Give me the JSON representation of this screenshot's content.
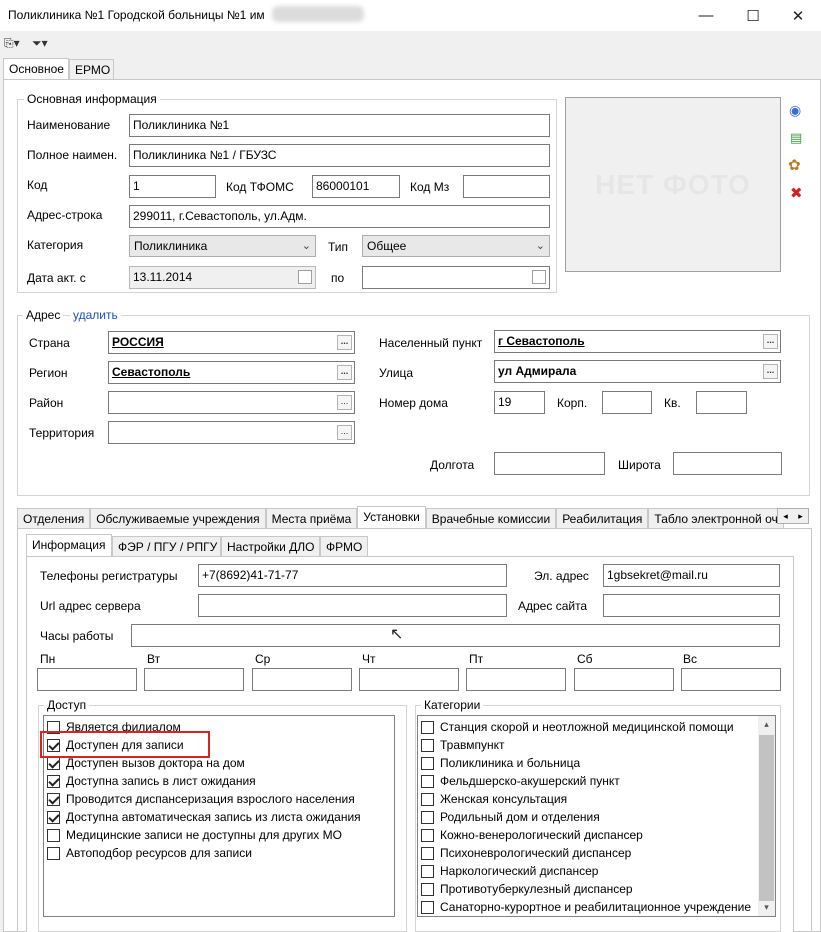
{
  "window": {
    "title": "Поликлиника №1 Городской больницы №1 им"
  },
  "top_tabs": [
    "Основное",
    "ЕРМО"
  ],
  "basic_info": {
    "title": "Основная информация",
    "name_label": "Наименование",
    "name_value": "Поликлиника №1",
    "fullname_label": "Полное наимен.",
    "fullname_value": "Поликлиника №1 / ГБУЗС",
    "code_label": "Код",
    "code_value": "1",
    "tfoms_label": "Код ТФОМС",
    "tfoms_value": "86000101",
    "mz_label": "Код Мз",
    "mz_value": "",
    "address_label": "Адрес-строка",
    "address_value": "299011, г.Севастополь, ул.Адм.",
    "category_label": "Категория",
    "category_value": "Поликлиника",
    "type_label": "Тип",
    "type_value": "Общее",
    "date_label": "Дата акт. с",
    "date_value": "13.11.2014",
    "to_label": "по"
  },
  "photo": {
    "placeholder": "НЕТ ФОТО"
  },
  "address": {
    "title": "Адрес",
    "delete_link": "удалить",
    "country_label": "Страна",
    "country_value": "РОССИЯ",
    "region_label": "Регион",
    "region_value": "Севастополь",
    "district_label": "Район",
    "territory_label": "Территория",
    "settlement_label": "Населенный пункт",
    "settlement_value": "г Севастополь",
    "street_label": "Улица",
    "street_value": "ул Адмирала",
    "house_label": "Номер дома",
    "house_value": "19",
    "korp_label": "Корп.",
    "kv_label": "Кв.",
    "lon_label": "Долгота",
    "lat_label": "Широта"
  },
  "section_tabs": [
    "Отделения",
    "Обслуживаемые учреждения",
    "Места приёма",
    "Установки",
    "Врачебные комиссии",
    "Реабилитация",
    "Табло электронной оч"
  ],
  "sub_tabs": [
    "Информация",
    "ФЭР / ПГУ / РПГУ",
    "Настройки ДЛО",
    "ФРМО"
  ],
  "info": {
    "phones_label": "Телефоны регистратуры",
    "phones_value": "+7(8692)41-71-77",
    "email_label": "Эл. адрес",
    "email_value": "1gbsekret@mail.ru",
    "url_label": "Url адрес сервера",
    "site_label": "Адрес сайта",
    "hours_label": "Часы работы",
    "days": [
      "Пн",
      "Вт",
      "Ср",
      "Чт",
      "Пт",
      "Сб",
      "Вс"
    ]
  },
  "access": {
    "title": "Доступ",
    "items": [
      {
        "label": "Является филиалом",
        "checked": false
      },
      {
        "label": "Доступен для записи",
        "checked": true
      },
      {
        "label": "Доступен вызов доктора на дом",
        "checked": true
      },
      {
        "label": "Доступна запись в лист ожидания",
        "checked": true
      },
      {
        "label": "Проводится диспансеризация взрослого населения",
        "checked": true
      },
      {
        "label": "Доступна автоматическая запись из листа ожидания",
        "checked": true
      },
      {
        "label": "Медицинские записи не доступны для других МО",
        "checked": false
      },
      {
        "label": "Автоподбор ресурсов для записи",
        "checked": false
      }
    ]
  },
  "categories": {
    "title": "Категории",
    "items": [
      "Станция скорой и неотложной медицинской помощи",
      "Травмпункт",
      "Поликлиника и больница",
      "Фельдшерско-акушерский пункт",
      "Женская консультация",
      "Родильный дом и отделения",
      "Кожно-венерологический диспансер",
      "Психоневрологический диспансер",
      "Наркологический диспансер",
      "Противотуберкулезный диспансер",
      "Санаторно-курортное и реабилитационное учреждение"
    ]
  },
  "colors": {
    "highlight": "#e02020",
    "link": "#1a4fc2"
  }
}
